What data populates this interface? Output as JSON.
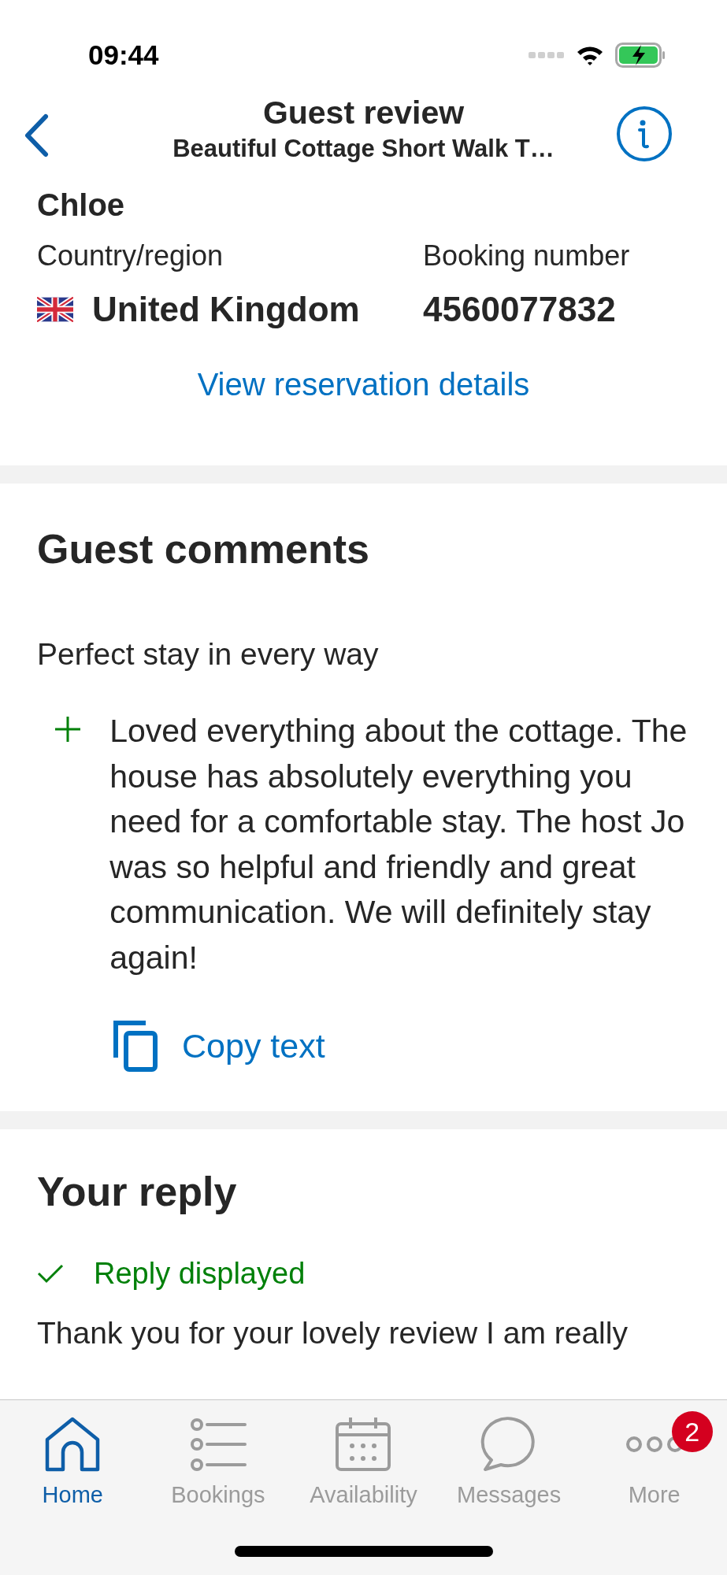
{
  "status_bar": {
    "time": "09:44"
  },
  "nav": {
    "title": "Guest review",
    "subtitle": "Beautiful Cottage Short Walk T…"
  },
  "guest": {
    "name": "Chloe",
    "country_label": "Country/region",
    "country": "United Kingdom",
    "booking_label": "Booking number",
    "booking_number": "4560077832",
    "link": "View reservation details"
  },
  "comments": {
    "heading": "Guest comments",
    "title": "Perfect stay in every way",
    "items": [
      {
        "kind": "positive",
        "text": "Loved everything about the cottage. The house has absolutely everything you need for a comfortable stay. The host Jo was so helpful and friendly and great communication. We will definitely stay again!"
      }
    ],
    "copy": "Copy text"
  },
  "reply": {
    "heading": "Your reply",
    "status": "Reply displayed",
    "text": "Thank you for your lovely review I am really"
  },
  "tabs": [
    {
      "kind": "home",
      "label": "Home",
      "selected": true
    },
    {
      "kind": "list",
      "label": "Bookings",
      "selected": false
    },
    {
      "kind": "calendar",
      "label": "Availability",
      "selected": false
    },
    {
      "kind": "chat",
      "label": "Messages",
      "selected": false
    },
    {
      "kind": "more",
      "label": "More",
      "selected": false,
      "badge": "2"
    }
  ]
}
